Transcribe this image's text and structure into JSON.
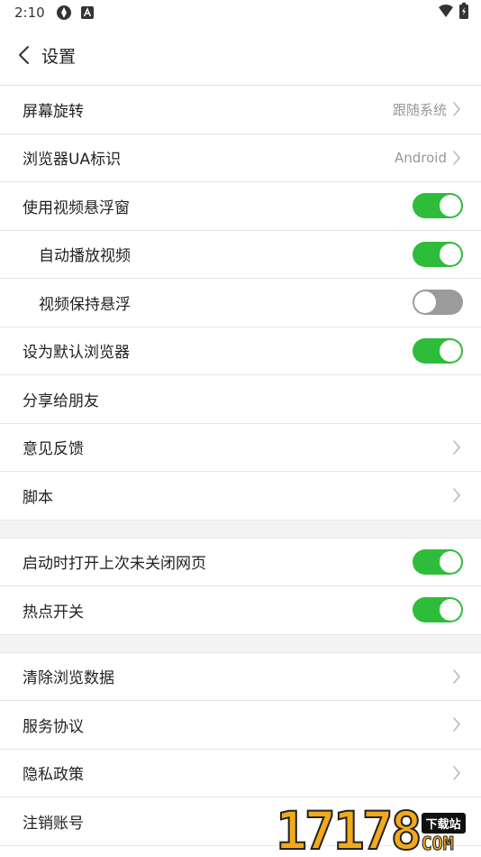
{
  "status_bar": {
    "time": "2:10",
    "icons": [
      "sync-icon",
      "a-badge-icon",
      "wifi-icon",
      "battery-icon"
    ]
  },
  "header": {
    "title": "设置",
    "back_icon": "chevron-left-icon"
  },
  "settings": {
    "screen_rotation": {
      "label": "屏幕旋转",
      "value": "跟随系统"
    },
    "browser_ua": {
      "label": "浏览器UA标识",
      "value": "Android"
    },
    "video_float": {
      "label": "使用视频悬浮窗",
      "on": true
    },
    "autoplay_video": {
      "label": "自动播放视频",
      "on": true
    },
    "keep_float": {
      "label": "视频保持悬浮",
      "on": false
    },
    "default_browser": {
      "label": "设为默认浏览器",
      "on": true
    },
    "share_friends": {
      "label": "分享给朋友"
    },
    "feedback": {
      "label": "意见反馈"
    },
    "scripts": {
      "label": "脚本"
    },
    "restore_tabs": {
      "label": "启动时打开上次未关闭网页",
      "on": true
    },
    "hotspot": {
      "label": "热点开关",
      "on": true
    },
    "clear_data": {
      "label": "清除浏览数据"
    },
    "service_agreement": {
      "label": "服务协议"
    },
    "privacy_policy": {
      "label": "隐私政策"
    },
    "delete_account": {
      "label": "注销账号"
    }
  },
  "watermark": {
    "number": "17178",
    "tag": "下载站",
    "domain": "COM"
  },
  "colors": {
    "toggle_on": "#2ebc3b",
    "toggle_off": "#9b9b9b",
    "divider": "#e6e6e6",
    "section_gap": "#f3f3f3",
    "muted_text": "#999999"
  }
}
